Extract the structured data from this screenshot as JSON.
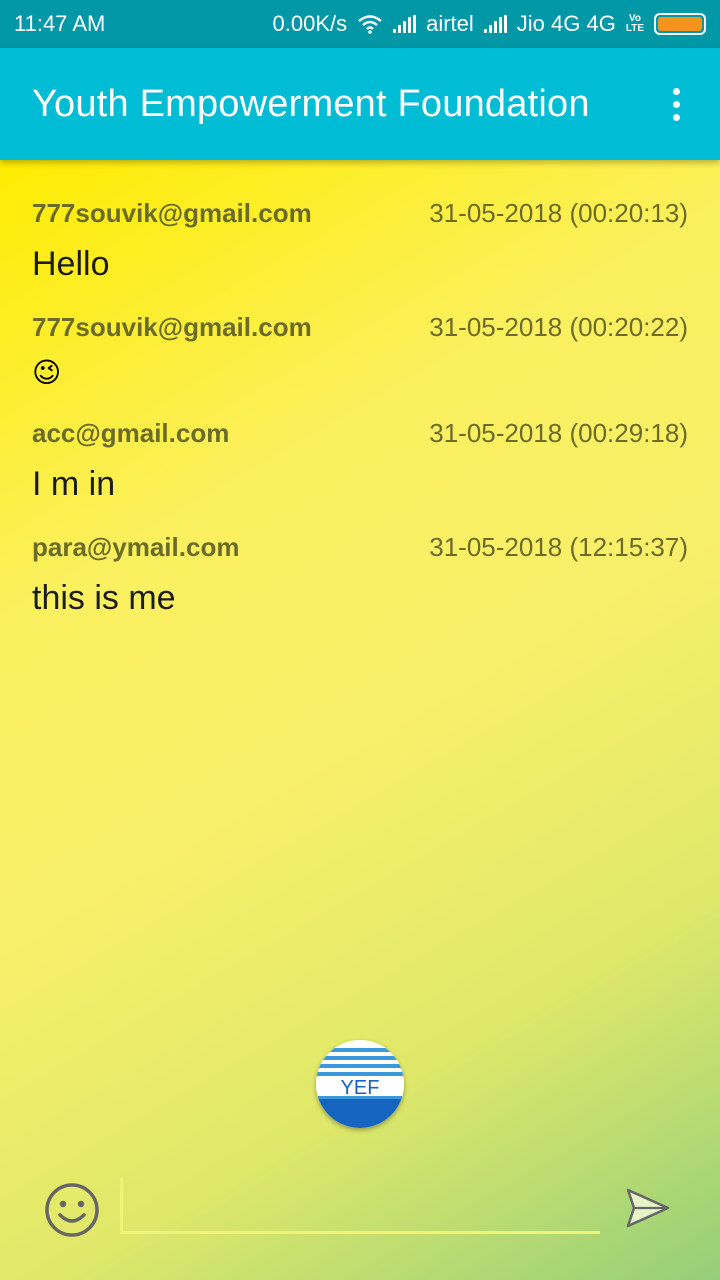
{
  "status_bar": {
    "time": "11:47 AM",
    "net_speed": "0.00K/s",
    "carrier1": "airtel",
    "carrier2": "Jio 4G 4G",
    "volte_line1": "Vo",
    "volte_line2": "LTE",
    "battery_color": "#f7941d"
  },
  "app_bar": {
    "title": "Youth Empowerment Foundation",
    "menu_icon": "more-vert-icon",
    "color": "#00bcd4"
  },
  "messages": [
    {
      "sender": "777souvik@gmail.com",
      "timestamp": "31-05-2018 (00:20:13)",
      "text": "Hello"
    },
    {
      "sender": "777souvik@gmail.com",
      "timestamp": "31-05-2018 (00:20:22)",
      "text": "😉"
    },
    {
      "sender": "acc@gmail.com",
      "timestamp": "31-05-2018 (00:29:18)",
      "text": "I m in"
    },
    {
      "sender": "para@ymail.com",
      "timestamp": "31-05-2018 (12:15:37)",
      "text": "this is me"
    }
  ],
  "logo": {
    "text": "YEF"
  },
  "composer": {
    "emoji_icon": "smiley-icon",
    "input_value": "",
    "send_icon": "send-icon"
  }
}
